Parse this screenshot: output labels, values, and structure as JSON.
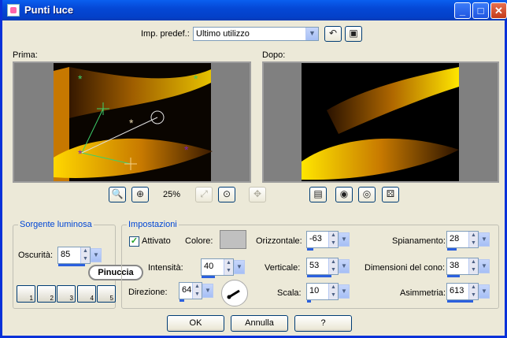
{
  "window": {
    "title": "Punti luce"
  },
  "preset": {
    "label": "Imp. predef.:",
    "value": "Ultimo utilizzo"
  },
  "preview": {
    "before_label": "Prima:",
    "after_label": "Dopo:",
    "zoom": "25%"
  },
  "light_source": {
    "title": "Sorgente luminosa",
    "darkness_label": "Oscurità:",
    "darkness_value": "85",
    "darkness_level": 0.85,
    "presets": [
      "1",
      "2",
      "3",
      "4",
      "5"
    ]
  },
  "badge": {
    "text": "Pinuccia"
  },
  "settings": {
    "title": "Impostazioni",
    "enabled_label": "Attivato",
    "enabled": true,
    "color_label": "Colore:",
    "color_value": "#c0c0c0",
    "intensity_label": "Intensità:",
    "intensity_value": "40",
    "direction_label": "Direzione:",
    "direction_value": "64",
    "horizontal_label": "Orizzontale:",
    "horizontal_value": "-63",
    "vertical_label": "Verticale:",
    "vertical_value": "53",
    "scale_label": "Scala:",
    "scale_value": "10",
    "flattening_label": "Spianamento:",
    "flattening_value": "28",
    "cone_label": "Dimensioni del cono:",
    "cone_value": "38",
    "asymmetry_label": "Asimmetria:",
    "asymmetry_value": "613"
  },
  "buttons": {
    "ok": "OK",
    "cancel": "Annulla",
    "help": "?"
  },
  "icons": {
    "title_icon": "app-icon",
    "minimize": "minimize-icon",
    "maximize": "maximize-icon",
    "close": "close-icon"
  }
}
